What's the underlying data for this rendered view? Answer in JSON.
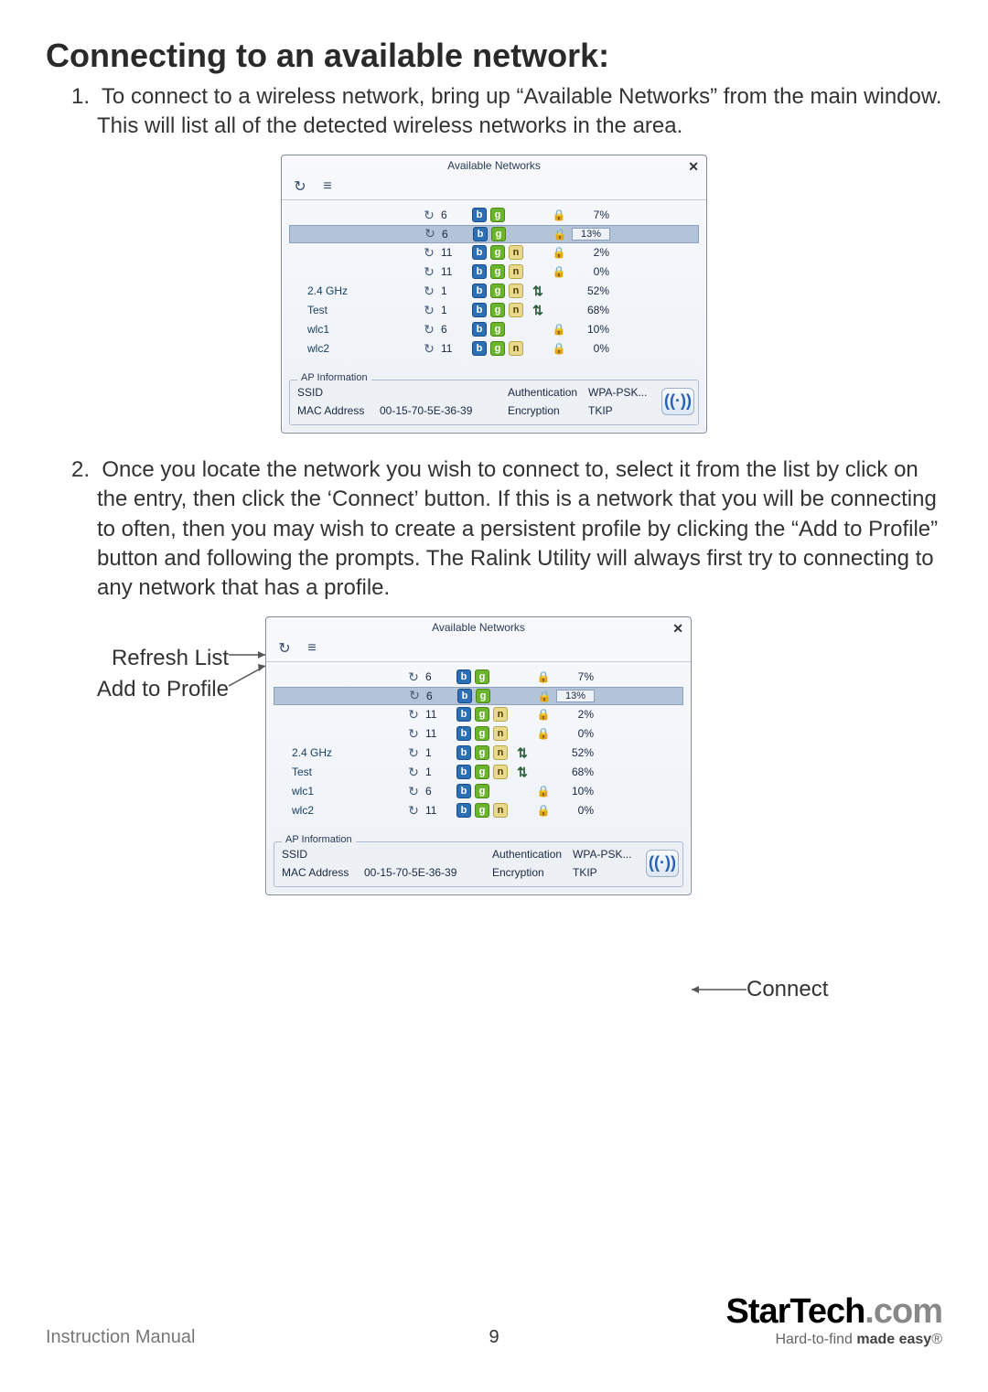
{
  "heading": "Connecting to an available network:",
  "step1_num": "1.",
  "step1": "To connect to a wireless network, bring up “Available Networks” from the main window.  This will list all of the detected wireless networks in the area.",
  "step2_num": "2.",
  "step2": "Once you locate the network you wish to connect to, select it from the list by click on the entry, then click the ‘Connect’ button.  If this is a network that you will be connecting to often, then you may wish to create a persistent profile by clicking the “Add to Profile” button and following the prompts.  The Ralink Utility will always first try to connecting to any network that has a profile.",
  "window": {
    "title": "Available Networks",
    "close": "✕",
    "toolbar_refresh": "↻",
    "toolbar_list": "≡"
  },
  "networks": [
    {
      "ssid": "",
      "ch": "6",
      "b": true,
      "g": true,
      "n": false,
      "conn": false,
      "sec": true,
      "sig": "7%",
      "sel": false
    },
    {
      "ssid": "",
      "ch": "6",
      "b": true,
      "g": true,
      "n": false,
      "conn": false,
      "sec": true,
      "sig": "13%",
      "sel": true
    },
    {
      "ssid": "",
      "ch": "11",
      "b": true,
      "g": true,
      "n": true,
      "conn": false,
      "sec": true,
      "sig": "2%",
      "sel": false
    },
    {
      "ssid": "",
      "ch": "11",
      "b": true,
      "g": true,
      "n": true,
      "conn": false,
      "sec": true,
      "sig": "0%",
      "sel": false
    },
    {
      "ssid": "2.4 GHz",
      "ch": "1",
      "b": true,
      "g": true,
      "n": true,
      "conn": true,
      "sec": false,
      "sig": "52%",
      "sel": false
    },
    {
      "ssid": "Test",
      "ch": "1",
      "b": true,
      "g": true,
      "n": true,
      "conn": true,
      "sec": false,
      "sig": "68%",
      "sel": false
    },
    {
      "ssid": "wlc1",
      "ch": "6",
      "b": true,
      "g": true,
      "n": false,
      "conn": false,
      "sec": true,
      "sig": "10%",
      "sel": false
    },
    {
      "ssid": "wlc2",
      "ch": "11",
      "b": true,
      "g": true,
      "n": true,
      "conn": false,
      "sec": true,
      "sig": "0%",
      "sel": false
    }
  ],
  "ap": {
    "legend": "AP Information",
    "ssid_label": "SSID",
    "ssid_value": "",
    "mac_label": "MAC Address",
    "mac_value": "00-15-70-5E-36-39",
    "auth_label": "Authentication",
    "auth_value": "WPA-PSK...",
    "enc_label": "Encryption",
    "enc_value": "TKIP",
    "connect_glyph": "((·))"
  },
  "callouts": {
    "refresh": "Refresh List",
    "add_profile": "Add to Profile",
    "connect": "Connect"
  },
  "footer": {
    "left": "Instruction Manual",
    "page": "9",
    "brand_main": "StarTech",
    "brand_dotcom": ".com",
    "tagline_a": "Hard-to-find ",
    "tagline_b": "made easy",
    "reg": "®"
  }
}
